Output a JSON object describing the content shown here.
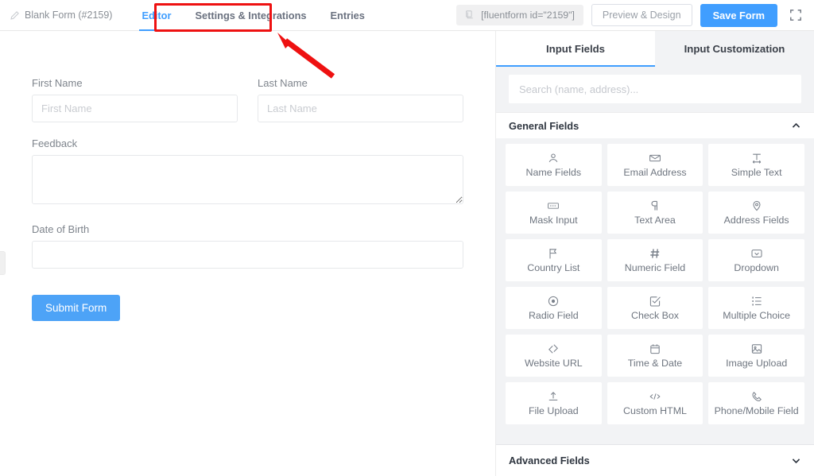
{
  "header": {
    "form_name": "Blank Form (#2159)",
    "form_name_icon": "pencil-icon",
    "tabs": [
      {
        "label": "Editor",
        "active": true
      },
      {
        "label": "Settings & Integrations",
        "active": false
      },
      {
        "label": "Entries",
        "active": false
      }
    ],
    "shortcode": "[fluentform id=\"2159\"]",
    "shortcode_icon": "copy-icon",
    "preview_label": "Preview & Design",
    "save_label": "Save Form",
    "expand_icon": "fullscreen-icon",
    "accent_color": "#409eff"
  },
  "form": {
    "fields": [
      {
        "label": "First Name",
        "placeholder": "First Name",
        "type": "text"
      },
      {
        "label": "Last Name",
        "placeholder": "Last Name",
        "type": "text"
      },
      {
        "label": "Feedback",
        "placeholder": "",
        "type": "textarea"
      },
      {
        "label": "Date of Birth",
        "placeholder": "",
        "type": "text"
      }
    ],
    "submit_label": "Submit Form",
    "submit_color": "#4da3f7"
  },
  "panel": {
    "tabs": [
      {
        "label": "Input Fields",
        "active": true
      },
      {
        "label": "Input Customization",
        "active": false
      }
    ],
    "search": {
      "placeholder": "Search (name, address)...",
      "value": ""
    },
    "sections": [
      {
        "title": "General Fields",
        "expanded": true,
        "chevron": "chevron-up-icon",
        "items": [
          {
            "label": "Name Fields",
            "icon": "user-icon"
          },
          {
            "label": "Email Address",
            "icon": "envelope-icon"
          },
          {
            "label": "Simple Text",
            "icon": "text-width-icon"
          },
          {
            "label": "Mask Input",
            "icon": "mask-icon"
          },
          {
            "label": "Text Area",
            "icon": "paragraph-icon"
          },
          {
            "label": "Address Fields",
            "icon": "map-pin-icon"
          },
          {
            "label": "Country List",
            "icon": "flag-icon"
          },
          {
            "label": "Numeric Field",
            "icon": "hash-icon"
          },
          {
            "label": "Dropdown",
            "icon": "dropdown-icon"
          },
          {
            "label": "Radio Field",
            "icon": "radio-icon"
          },
          {
            "label": "Check Box",
            "icon": "checkbox-icon"
          },
          {
            "label": "Multiple Choice",
            "icon": "list-icon"
          },
          {
            "label": "Website URL",
            "icon": "link-icon"
          },
          {
            "label": "Time & Date",
            "icon": "calendar-icon"
          },
          {
            "label": "Image Upload",
            "icon": "image-icon"
          },
          {
            "label": "File Upload",
            "icon": "upload-icon"
          },
          {
            "label": "Custom HTML",
            "icon": "code-icon"
          },
          {
            "label": "Phone/Mobile Field",
            "icon": "phone-icon"
          }
        ]
      },
      {
        "title": "Advanced Fields",
        "expanded": false,
        "chevron": "chevron-down-icon",
        "items": []
      }
    ]
  },
  "annotations": {
    "highlight_color": "#ee1111",
    "highlight_target": "Settings & Integrations",
    "arrow": "red-arrow-pointing-to-settings-tab"
  }
}
